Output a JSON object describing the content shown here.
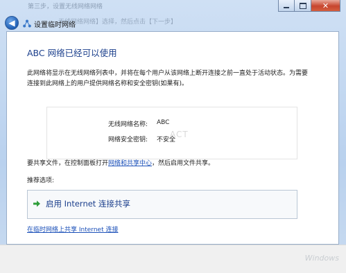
{
  "window": {
    "title_overlay": "第三步，设置无线网络网络",
    "subtitle_overlay": "无线网络网络】选择，然后点击【下一步】",
    "minimize_glyph": "−",
    "maximize_glyph": "□",
    "close_glyph": "✕"
  },
  "nav": {
    "back_glyph": "◀",
    "title": "设置临时网络"
  },
  "main": {
    "heading": "ABC 网络已经可以使用",
    "description": "此网络将显示在无线网络列表中，并将在每个用户从该网络上断开连接之前一直处于活动状态。为需要连接到此网络上的用户提供网络名称和安全密钥(如果有)。",
    "info": {
      "name_label": "无线网络名称:",
      "name_value": "ABC",
      "key_label": "网络安全密钥:",
      "key_value": "不安全",
      "watermark": "ACT"
    },
    "share_prefix": "要共享文件，在控制面板打开",
    "share_link": "网络和共享中心",
    "share_suffix": "，然后启用文件共享。",
    "recommended_label": "推荐选项:",
    "command_link_label": "启用 Internet 连接共享",
    "bottom_link": "在临时网络上共享 Internet 连接"
  },
  "footer": {
    "watermark": "Windows"
  },
  "colors": {
    "heading": "#1b3f8c",
    "link": "#1a4fb8",
    "frame": "#b9d1ee",
    "arrow_green": "#2f9e3a"
  },
  "icons": {
    "back": "back-arrow-icon",
    "wizard": "adhoc-network-icon",
    "command": "green-arrow-icon"
  }
}
